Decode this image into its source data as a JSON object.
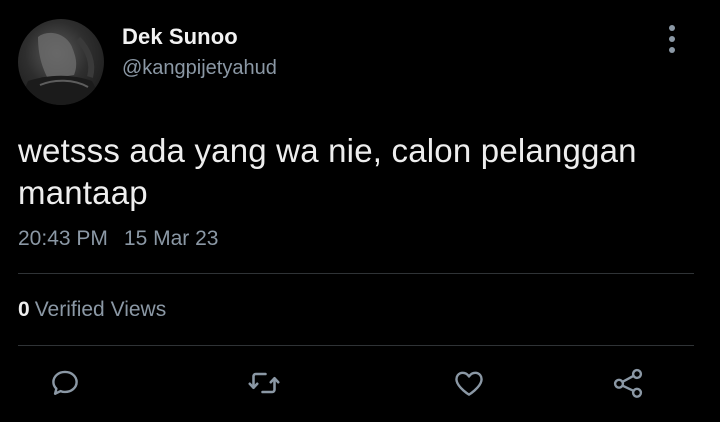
{
  "tweet": {
    "author": {
      "display_name": "Dek Sunoo",
      "handle": "@kangpijetyahud",
      "avatar_icon": "profile-photo"
    },
    "text": "wetsss ada yang wa nie, calon pelanggan mantaap",
    "time": "20:43 PM",
    "date": "15 Mar 23",
    "views": {
      "count": "0",
      "label": "Verified Views"
    },
    "actions": {
      "reply_icon": "speech-bubble-icon",
      "retweet_icon": "retweet-icon",
      "like_icon": "heart-icon",
      "share_icon": "share-nodes-icon"
    },
    "menu_icon": "vertical-ellipsis-icon"
  },
  "colors": {
    "background": "#000000",
    "primary_text": "#eeeeee",
    "secondary_text": "#8b98a5",
    "divider": "#2f3336"
  }
}
